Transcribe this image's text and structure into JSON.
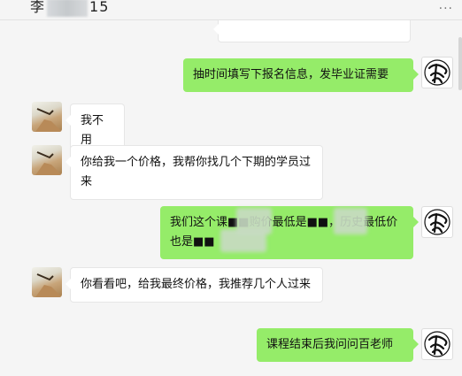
{
  "header": {
    "title_prefix": "李",
    "title_suffix": "15",
    "more": "···"
  },
  "messages": [
    {
      "from": "me",
      "text": "抽时间填写下报名信息，发毕业证需要"
    },
    {
      "from": "contact",
      "text": "我不用"
    },
    {
      "from": "contact",
      "text": "你给我一个价格，我帮你找几个下期的学员过来"
    },
    {
      "from": "me",
      "text": "我们这个课■■购价最低是■■，历史最低价也是■■"
    },
    {
      "from": "contact",
      "text": "你看看吧，给我最终价格，我推荐几个人过来"
    },
    {
      "from": "me",
      "text": "课程结束后我问问百老师"
    }
  ],
  "avatars": {
    "me_icon": "calligraphy-seal-icon",
    "contact_icon": "bird-on-rock-photo"
  }
}
